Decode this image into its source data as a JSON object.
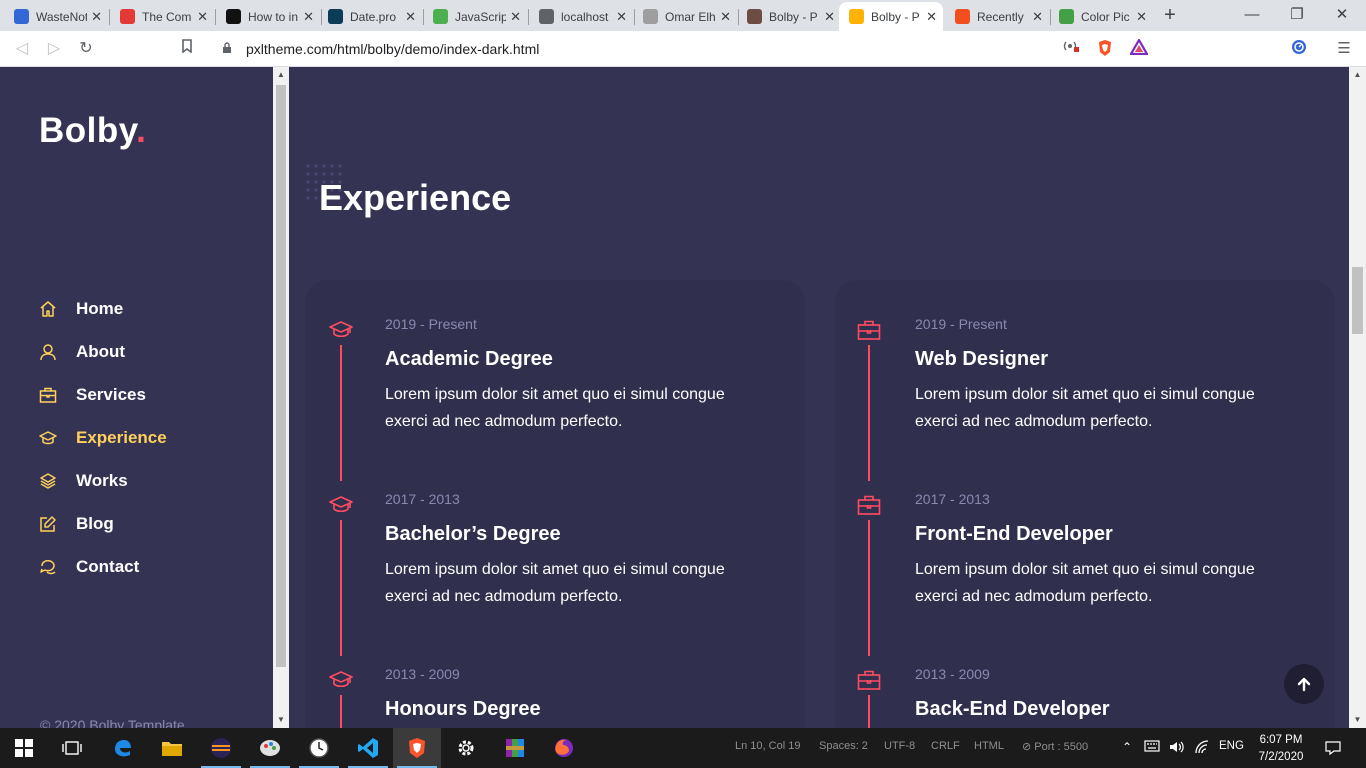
{
  "browser": {
    "tabs": [
      {
        "title": "WasteNot",
        "icon": "wastenot-icon",
        "color": "#3367d6",
        "active": false
      },
      {
        "title": "The Com",
        "icon": "u-logo-icon",
        "color": "#e53935",
        "active": false
      },
      {
        "title": "How to in",
        "icon": "r-logo-icon",
        "color": "#111111",
        "active": false
      },
      {
        "title": "Date.pro",
        "icon": "elephant-icon",
        "color": "#0d3d56",
        "active": false
      },
      {
        "title": "JavaScrip",
        "icon": "w3-icon",
        "color": "#4caf50",
        "active": false
      },
      {
        "title": "localhost",
        "icon": "globe-icon",
        "color": "#5f6368",
        "active": false
      },
      {
        "title": "Omar Elh",
        "icon": "w-logo-icon",
        "color": "#9e9e9e",
        "active": false
      },
      {
        "title": "Bolby - P",
        "icon": "photo-icon",
        "color": "#6d4c41",
        "active": false
      },
      {
        "title": "Bolby - P",
        "icon": "avatar-icon",
        "color": "#ffb300",
        "active": true
      },
      {
        "title": "Recently",
        "icon": "figma-icon",
        "color": "#f24e1e",
        "active": false
      },
      {
        "title": "Color Pic",
        "icon": "g-logo-icon",
        "color": "#43a047",
        "active": false
      }
    ],
    "new_tab_symbol": "+",
    "url": "pxltheme.com/html/bolby/demo/index-dark.html"
  },
  "site": {
    "logo_text": "Bolby",
    "logo_dot": ".",
    "accent_color": "#ff4c60",
    "nav_active_color": "#ffd15c",
    "nav": [
      {
        "label": "Home",
        "icon": "home-icon",
        "active": false
      },
      {
        "label": "About",
        "icon": "user-icon",
        "active": false
      },
      {
        "label": "Services",
        "icon": "briefcase-icon",
        "active": false
      },
      {
        "label": "Experience",
        "icon": "graduation-cap-icon",
        "active": true
      },
      {
        "label": "Works",
        "icon": "layers-icon",
        "active": false
      },
      {
        "label": "Blog",
        "icon": "edit-icon",
        "active": false
      },
      {
        "label": "Contact",
        "icon": "chat-icon",
        "active": false
      }
    ],
    "copyright": "© 2020 Bolby Template"
  },
  "experience": {
    "title": "Experience",
    "education": [
      {
        "date": "2019 - Present",
        "title": "Academic Degree",
        "text": "Lorem ipsum dolor sit amet quo ei simul congue exerci ad nec admodum perfecto."
      },
      {
        "date": "2017 - 2013",
        "title": "Bachelor’s Degree",
        "text": "Lorem ipsum dolor sit amet quo ei simul congue exerci ad nec admodum perfecto."
      },
      {
        "date": "2013 - 2009",
        "title": "Honours Degree",
        "text": ""
      }
    ],
    "work": [
      {
        "date": "2019 - Present",
        "title": "Web Designer",
        "text": "Lorem ipsum dolor sit amet quo ei simul congue exerci ad nec admodum perfecto."
      },
      {
        "date": "2017 - 2013",
        "title": "Front-End Developer",
        "text": "Lorem ipsum dolor sit amet quo ei simul congue exerci ad nec admodum perfecto."
      },
      {
        "date": "2013 - 2009",
        "title": "Back-End Developer",
        "text": ""
      }
    ]
  },
  "taskbar": {
    "status_items": [
      "Ln 10, Col 19",
      "Spaces: 2",
      "UTF-8",
      "CRLF",
      "HTML",
      "⊘ Port : 5500"
    ],
    "language": "ENG",
    "time": "6:07 PM",
    "date": "7/2/2020"
  }
}
